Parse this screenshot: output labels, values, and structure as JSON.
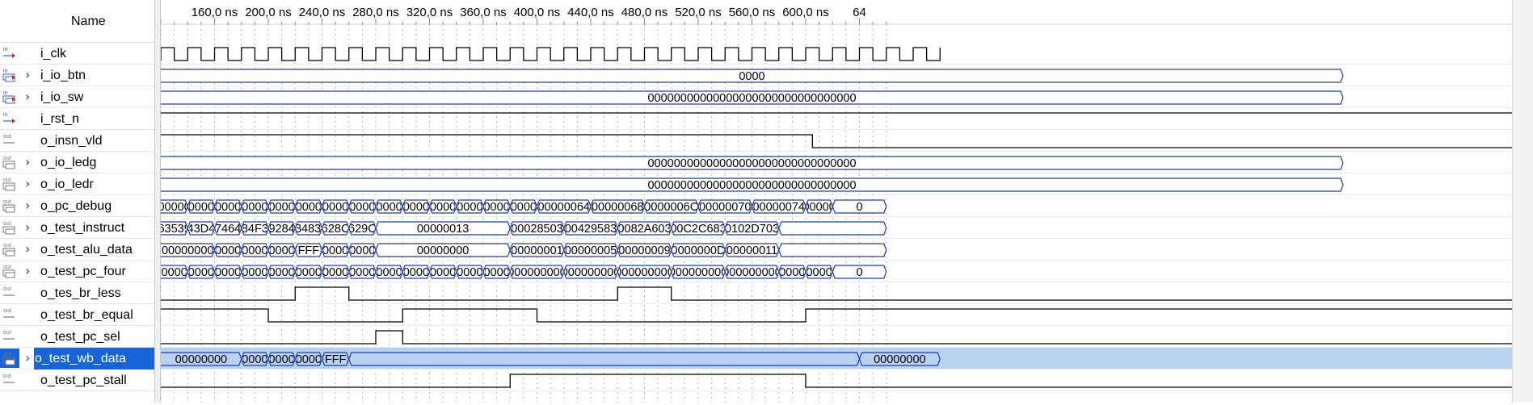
{
  "name_column_title": "Name",
  "time_ticks": [
    "160,0 ns",
    "200,0 ns",
    "240,0 ns",
    "280,0 ns",
    "320,0 ns",
    "360,0 ns",
    "400,0 ns",
    "440,0 ns",
    "480,0 ns",
    "520,0 ns",
    "560,0 ns",
    "600,0 ns",
    "64"
  ],
  "signals": [
    {
      "name": "i_clk",
      "dir": "in",
      "bus": false,
      "kind": "clock"
    },
    {
      "name": "i_io_btn",
      "dir": "in",
      "bus": true,
      "kind": "bus",
      "segs": [
        [
          0,
          1000,
          "0000"
        ]
      ]
    },
    {
      "name": "i_io_sw",
      "dir": "in",
      "bus": true,
      "kind": "bus",
      "segs": [
        [
          0,
          1000,
          "00000000000000000000000000000000"
        ]
      ]
    },
    {
      "name": "i_rst_n",
      "dir": "in",
      "bus": false,
      "kind": "bit",
      "edges": [
        [
          0,
          1
        ]
      ]
    },
    {
      "name": "o_insn_vld",
      "dir": "out",
      "bus": false,
      "kind": "bit",
      "edges": [
        [
          0,
          1
        ],
        [
          605,
          0
        ]
      ]
    },
    {
      "name": "o_io_ledg",
      "dir": "out",
      "bus": true,
      "kind": "bus",
      "segs": [
        [
          0,
          1000,
          "00000000000000000000000000000000"
        ]
      ]
    },
    {
      "name": "o_io_ledr",
      "dir": "out",
      "bus": true,
      "kind": "bus",
      "segs": [
        [
          0,
          1000,
          "00000000000000000000000000000000"
        ]
      ]
    },
    {
      "name": "o_pc_debug",
      "dir": "out",
      "bus": true,
      "kind": "bus",
      "segs": [
        [
          -20,
          140,
          "0000001"
        ],
        [
          140,
          160,
          "000001"
        ],
        [
          160,
          180,
          "000002"
        ],
        [
          180,
          200,
          "000002"
        ],
        [
          200,
          220,
          "000002"
        ],
        [
          220,
          240,
          "000002"
        ],
        [
          240,
          260,
          "000003"
        ],
        [
          260,
          280,
          "000003"
        ],
        [
          280,
          300,
          "000003"
        ],
        [
          300,
          320,
          "000005"
        ],
        [
          320,
          340,
          "000005"
        ],
        [
          340,
          360,
          "000005"
        ],
        [
          360,
          380,
          "000005"
        ],
        [
          380,
          400,
          "000006"
        ],
        [
          400,
          440,
          "00000064"
        ],
        [
          440,
          480,
          "00000068"
        ],
        [
          480,
          520,
          "0000006C"
        ],
        [
          520,
          560,
          "00000070"
        ],
        [
          560,
          600,
          "00000074"
        ],
        [
          600,
          620,
          "0000007"
        ],
        [
          620,
          660,
          "0"
        ]
      ]
    },
    {
      "name": "o_test_instruct",
      "dir": "out",
      "bus": true,
      "kind": "bus",
      "segs": [
        [
          -20,
          140,
          "63539"
        ],
        [
          140,
          160,
          "043D41"
        ],
        [
          160,
          180,
          "074649"
        ],
        [
          180,
          200,
          "084F31"
        ],
        [
          200,
          220,
          "092843"
        ],
        [
          220,
          240,
          "08483B"
        ],
        [
          240,
          260,
          "0628C6"
        ],
        [
          260,
          280,
          "0629C6"
        ],
        [
          280,
          380,
          "00000013"
        ],
        [
          380,
          420,
          "00028503"
        ],
        [
          420,
          460,
          "00429583"
        ],
        [
          460,
          500,
          "0082A603"
        ],
        [
          500,
          540,
          "00C2C683"
        ],
        [
          540,
          580,
          "0102D703"
        ],
        [
          580,
          660,
          ""
        ]
      ]
    },
    {
      "name": "o_test_alu_data",
      "dir": "out",
      "bus": true,
      "kind": "bus",
      "segs": [
        [
          -20,
          160,
          "00000000"
        ],
        [
          160,
          180,
          "000000"
        ],
        [
          180,
          200,
          "000000"
        ],
        [
          200,
          220,
          "000000"
        ],
        [
          220,
          240,
          "FFFFFFF"
        ],
        [
          240,
          260,
          "000004"
        ],
        [
          260,
          280,
          "000005"
        ],
        [
          280,
          380,
          "00000000"
        ],
        [
          380,
          420,
          "00000001"
        ],
        [
          420,
          460,
          "00000005"
        ],
        [
          460,
          500,
          "00000009"
        ],
        [
          500,
          540,
          "0000000D"
        ],
        [
          540,
          580,
          "00000011"
        ],
        [
          580,
          660,
          ""
        ]
      ]
    },
    {
      "name": "o_test_pc_four",
      "dir": "out",
      "bus": true,
      "kind": "bus",
      "segs": [
        [
          -20,
          140,
          "000000"
        ],
        [
          140,
          160,
          "000000"
        ],
        [
          160,
          180,
          "000000"
        ],
        [
          180,
          200,
          "000000"
        ],
        [
          200,
          220,
          "000000"
        ],
        [
          220,
          240,
          "000000"
        ],
        [
          240,
          260,
          "000000"
        ],
        [
          260,
          280,
          "000000"
        ],
        [
          280,
          300,
          "000000"
        ],
        [
          300,
          320,
          "000000"
        ],
        [
          320,
          340,
          "000000"
        ],
        [
          340,
          360,
          "000000"
        ],
        [
          360,
          380,
          "000000"
        ],
        [
          380,
          420,
          "0000000000000"
        ],
        [
          420,
          460,
          "0000000000000"
        ],
        [
          460,
          500,
          "0000000000000"
        ],
        [
          500,
          540,
          "0000000000000"
        ],
        [
          540,
          580,
          "0000000000000"
        ],
        [
          580,
          600,
          "000000"
        ],
        [
          600,
          620,
          "000000"
        ],
        [
          620,
          660,
          "0"
        ]
      ]
    },
    {
      "name": "o_tes_br_less",
      "dir": "out",
      "bus": false,
      "kind": "bit",
      "edges": [
        [
          -20,
          0
        ],
        [
          220,
          1
        ],
        [
          260,
          0
        ],
        [
          460,
          1
        ],
        [
          500,
          0
        ]
      ]
    },
    {
      "name": "o_test_br_equal",
      "dir": "out",
      "bus": false,
      "kind": "bit",
      "edges": [
        [
          -20,
          1
        ],
        [
          200,
          0
        ],
        [
          300,
          1
        ],
        [
          400,
          0
        ],
        [
          600,
          1
        ]
      ]
    },
    {
      "name": "o_test_pc_sel",
      "dir": "out",
      "bus": false,
      "kind": "bit",
      "edges": [
        [
          -20,
          0
        ],
        [
          280,
          1
        ],
        [
          300,
          0
        ]
      ]
    },
    {
      "name": "o_test_wb_data",
      "dir": "out",
      "bus": true,
      "kind": "bus",
      "selected": true,
      "segs": [
        [
          -20,
          180,
          "00000000"
        ],
        [
          180,
          200,
          "000000"
        ],
        [
          200,
          220,
          "000000"
        ],
        [
          220,
          240,
          "000000"
        ],
        [
          240,
          260,
          "FFFFFFF"
        ],
        [
          260,
          640,
          ""
        ],
        [
          640,
          700,
          "00000000"
        ]
      ]
    },
    {
      "name": "o_test_pc_stall",
      "dir": "out",
      "bus": false,
      "kind": "bit",
      "edges": [
        [
          -20,
          0
        ],
        [
          380,
          1
        ],
        [
          600,
          0
        ]
      ]
    }
  ],
  "colors": {
    "wave": "#000000",
    "bus_stroke": "#1f3fa8",
    "clock": "#000000",
    "grid": "#aeb4bf",
    "selection": "#1664d8",
    "highlight": "#b9d2f0",
    "in_icon": "#3b5fc4",
    "out_icon": "#7a7a7a"
  },
  "timeline": {
    "t_start": 140,
    "t_end": 640,
    "unit": "ns",
    "clock_period": 20
  }
}
